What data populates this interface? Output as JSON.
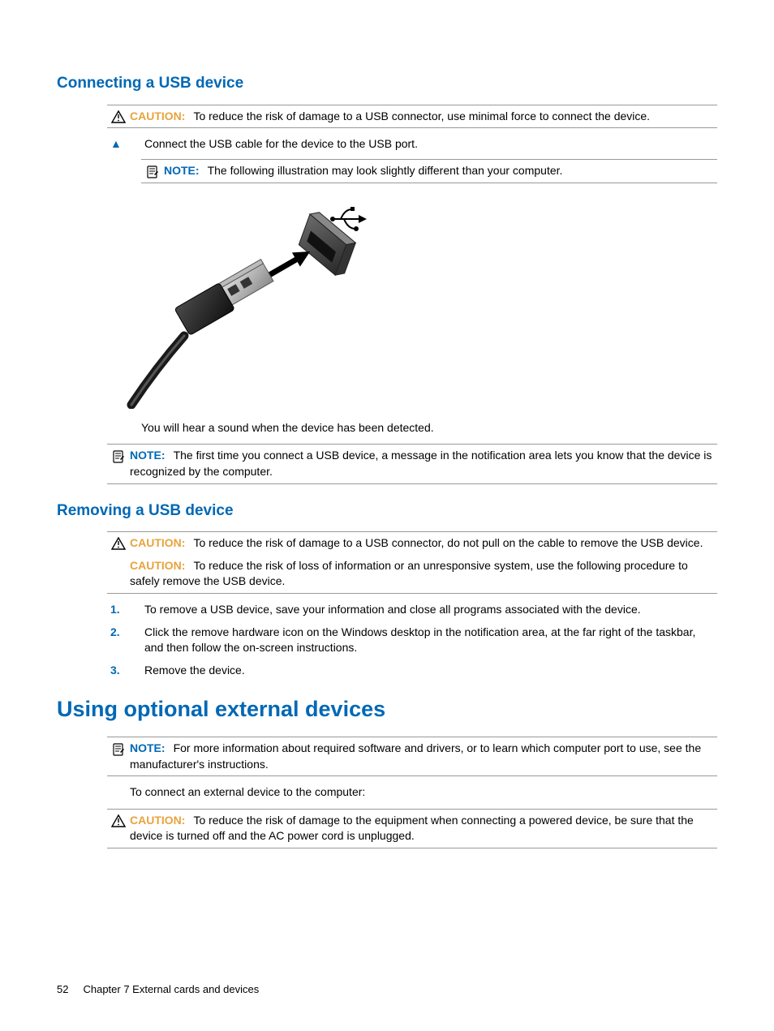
{
  "section1": {
    "title": "Connecting a USB device",
    "caution1": {
      "label": "CAUTION:",
      "text": "To reduce the risk of damage to a USB connector, use minimal force to connect the device."
    },
    "step1": {
      "mark": "▲",
      "text": "Connect the USB cable for the device to the USB port."
    },
    "note1": {
      "label": "NOTE:",
      "text": "The following illustration may look slightly different than your computer."
    },
    "illustration_alt": "USB cable connector being inserted into a USB port",
    "after_illus": "You will hear a sound when the device has been detected.",
    "note2": {
      "label": "NOTE:",
      "text": "The first time you connect a USB device, a message in the notification area lets you know that the device is recognized by the computer."
    }
  },
  "section2": {
    "title": "Removing a USB device",
    "caution1": {
      "label": "CAUTION:",
      "text": "To reduce the risk of damage to a USB connector, do not pull on the cable to remove the USB device."
    },
    "caution2": {
      "label": "CAUTION:",
      "text": "To reduce the risk of loss of information or an unresponsive system, use the following procedure to safely remove the USB device."
    },
    "steps": [
      {
        "mark": "1.",
        "text": "To remove a USB device, save your information and close all programs associated with the device."
      },
      {
        "mark": "2.",
        "text": "Click the remove hardware icon on the Windows desktop in the notification area, at the far right of the taskbar, and then follow the on-screen instructions."
      },
      {
        "mark": "3.",
        "text": "Remove the device."
      }
    ]
  },
  "section3": {
    "title": "Using optional external devices",
    "note1": {
      "label": "NOTE:",
      "text": "For more information about required software and drivers, or to learn which computer port to use, see the manufacturer's instructions."
    },
    "para": "To connect an external device to the computer:",
    "caution1": {
      "label": "CAUTION:",
      "text": "To reduce the risk of damage to the equipment when connecting a powered device, be sure that the device is turned off and the AC power cord is unplugged."
    }
  },
  "footer": {
    "page": "52",
    "chapter": "Chapter 7   External cards and devices"
  }
}
